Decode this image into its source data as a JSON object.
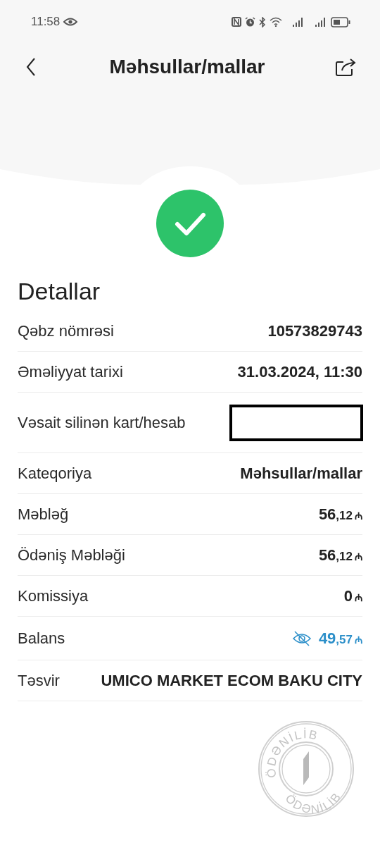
{
  "status_bar": {
    "time": "11:58"
  },
  "header": {
    "title": "Məhsullar/mallar"
  },
  "section_title": "Detallar",
  "rows": [
    {
      "kind": "text",
      "label": "Qəbz nömrəsi",
      "value": "10573829743"
    },
    {
      "kind": "text",
      "label": "Əməliyyat tarixi",
      "value": "31.03.2024, 11:30"
    },
    {
      "kind": "redacted",
      "label": "Vəsait silinən kart/hesab"
    },
    {
      "kind": "text",
      "label": "Kateqoriya",
      "value": "Məhsullar/mallar"
    },
    {
      "kind": "amount",
      "label": "Məbləğ",
      "whole": "56",
      "fraction": ",12",
      "currency": "₼"
    },
    {
      "kind": "amount",
      "label": "Ödəniş Məbləği",
      "whole": "56",
      "fraction": ",12",
      "currency": "₼"
    },
    {
      "kind": "amount",
      "label": "Komissiya",
      "whole": "0",
      "currency": "₼"
    },
    {
      "kind": "balance",
      "label": "Balans",
      "whole": "49",
      "fraction": ",57",
      "currency": "₼"
    },
    {
      "kind": "text",
      "label": "Təsvir",
      "value": "UMICO MARKET ECOM BAKU CITY"
    }
  ],
  "stamp": {
    "top_text": "ÖDƏNİLİB",
    "bottom_text": "ÖDƏNİLİB"
  }
}
